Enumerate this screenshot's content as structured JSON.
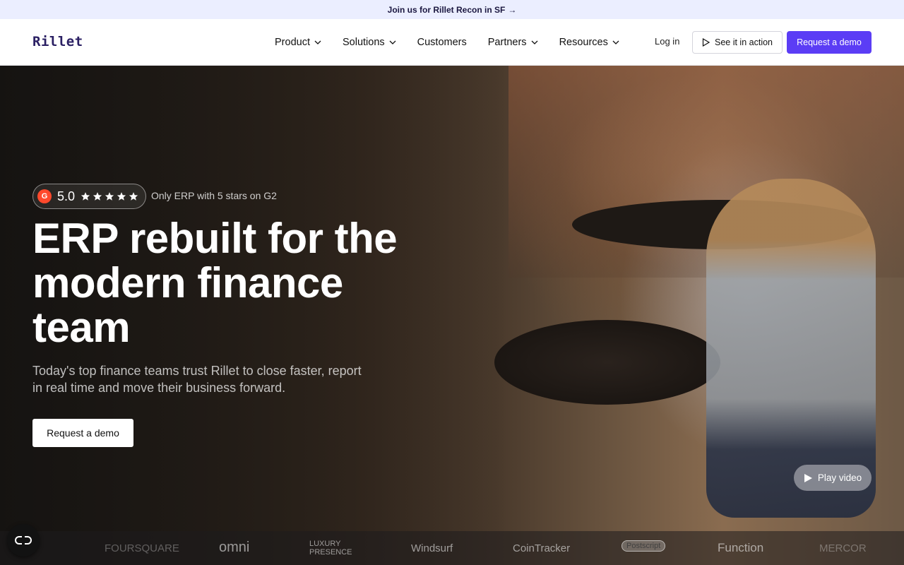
{
  "announcement": {
    "text": "Join us for Rillet Recon in SF",
    "arrow": "→"
  },
  "nav": {
    "logo": "Rillet",
    "menu": [
      {
        "label": "Product",
        "has_dropdown": true
      },
      {
        "label": "Solutions",
        "has_dropdown": true
      },
      {
        "label": "Customers",
        "has_dropdown": false
      },
      {
        "label": "Partners",
        "has_dropdown": true
      },
      {
        "label": "Resources",
        "has_dropdown": true
      }
    ],
    "login": "Log in",
    "see_it": "See it in action",
    "request_demo": "Request a demo"
  },
  "hero": {
    "rating": {
      "badge": "G",
      "score": "5.0",
      "stars": 5,
      "note": "Only ERP with 5 stars on G2"
    },
    "headline": "ERP rebuilt for the modern finance team",
    "subhead": "Today's top finance teams trust Rillet to close faster, report in real time and move their business forward.",
    "cta": "Request a demo",
    "play_video": "Play video"
  },
  "logos": [
    "FOURSQUARE",
    "omni",
    "LUXURY PRESENCE",
    "Windsurf",
    "CoinTracker",
    "Postscript",
    "Function",
    "MERCOR"
  ],
  "colors": {
    "accent": "#5b3df5",
    "announce_bg": "#ebeeff",
    "g2": "#ff492c"
  }
}
